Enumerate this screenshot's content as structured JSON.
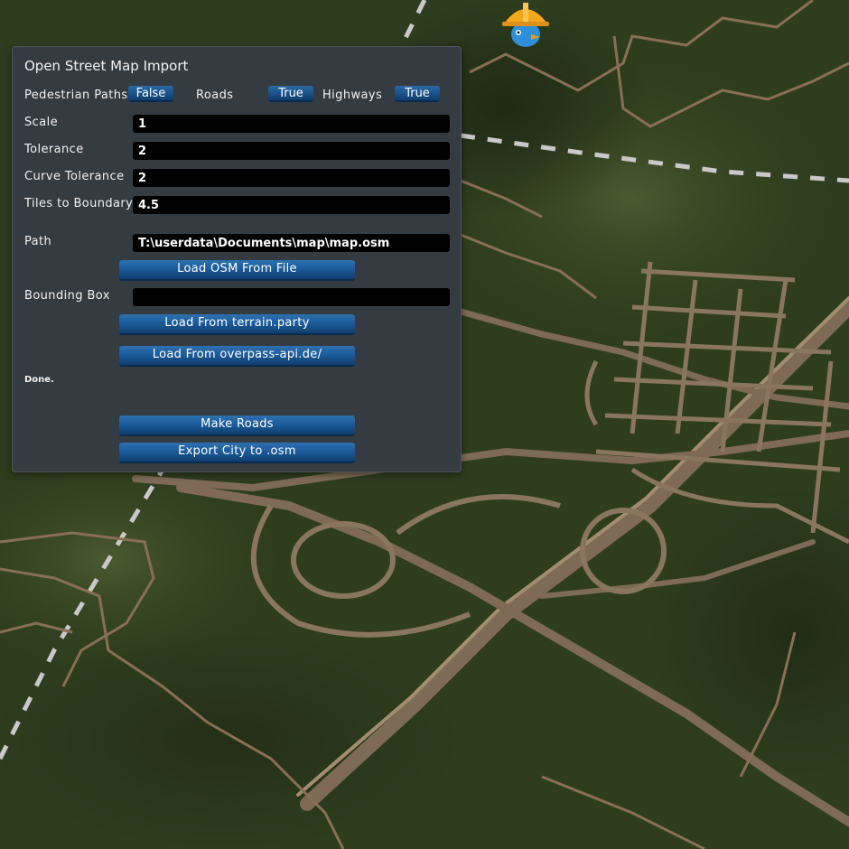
{
  "panel": {
    "title": "Open Street Map Import",
    "toggles": [
      {
        "label": "Pedestrian Paths",
        "value": "False"
      },
      {
        "label": "Roads",
        "value": "True"
      },
      {
        "label": "Highways",
        "value": "True"
      }
    ],
    "fields": {
      "scale": {
        "label": "Scale",
        "value": "1"
      },
      "tolerance": {
        "label": "Tolerance",
        "value": "2"
      },
      "curve_tolerance": {
        "label": "Curve Tolerance",
        "value": "2"
      },
      "tiles_to_boundary": {
        "label": "Tiles to Boundary",
        "value": "4.5"
      },
      "path": {
        "label": "Path",
        "value": "T:\\userdata\\Documents\\map\\map.osm"
      },
      "bounding_box": {
        "label": "Bounding Box",
        "value": ""
      }
    },
    "buttons": {
      "load_file": "Load OSM From File",
      "load_terrain_party": "Load From terrain.party",
      "load_overpass": "Load From overpass-api.de/",
      "make_roads": "Make Roads",
      "export_city": "Export City to .osm"
    },
    "status": "Done."
  },
  "colors": {
    "panel_bg": "#353c41",
    "button_blue": "#1a5a98",
    "road": "#8a7560",
    "terrain": "#2b3a1c"
  },
  "icons": {
    "mascot": "chirper-bird-hardhat-icon"
  }
}
